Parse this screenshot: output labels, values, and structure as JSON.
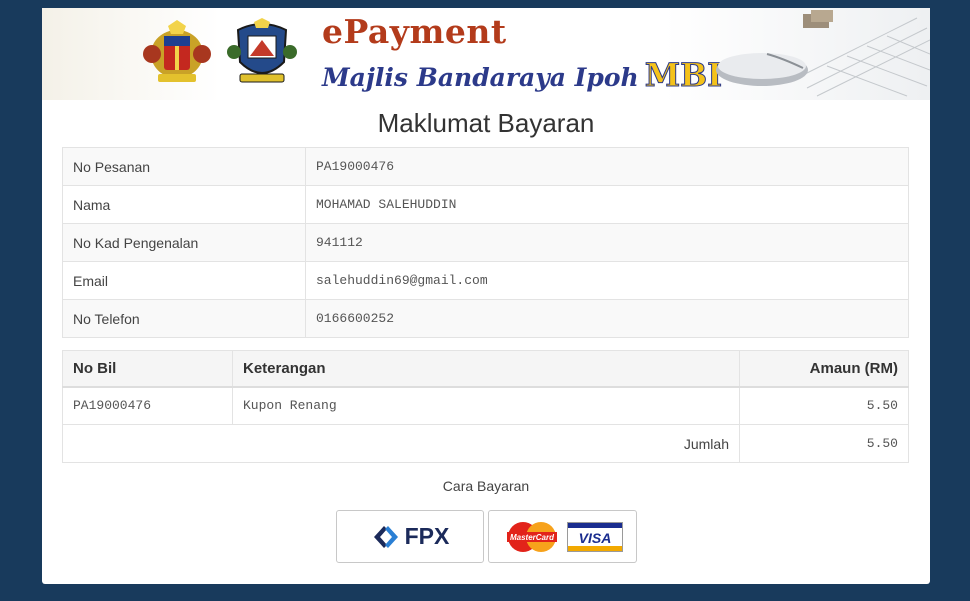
{
  "banner": {
    "brand_title": "ePayment",
    "brand_subtitle": "Majlis Bandaraya Ipoh",
    "brand_abbr": "MBI"
  },
  "page_title": "Maklumat Bayaran",
  "customer": [
    {
      "label": "No Pesanan",
      "value": "PA19000476"
    },
    {
      "label": "Nama",
      "value": "MOHAMAD SALEHUDDIN"
    },
    {
      "label": "No Kad Pengenalan",
      "value": "941112"
    },
    {
      "label": "Email",
      "value": "salehuddin69@gmail.com"
    },
    {
      "label": "No Telefon",
      "value": "0166600252"
    }
  ],
  "bill": {
    "headers": {
      "bill_no": "No Bil",
      "description": "Keterangan",
      "amount": "Amaun (RM)"
    },
    "rows": [
      {
        "bill_no": "PA19000476",
        "description": "Kupon Renang",
        "amount": "5.50"
      }
    ],
    "total_label": "Jumlah",
    "total_amount": "5.50"
  },
  "payment": {
    "title": "Cara Bayaran",
    "fpx_label": "FPX",
    "mastercard_label": "MasterCard",
    "visa_label": "VISA"
  },
  "colors": {
    "background": "#183a5c",
    "brand_red": "#b33b1b",
    "brand_blue": "#2c3a8a",
    "mbi_yellow": "#f4c21a"
  }
}
